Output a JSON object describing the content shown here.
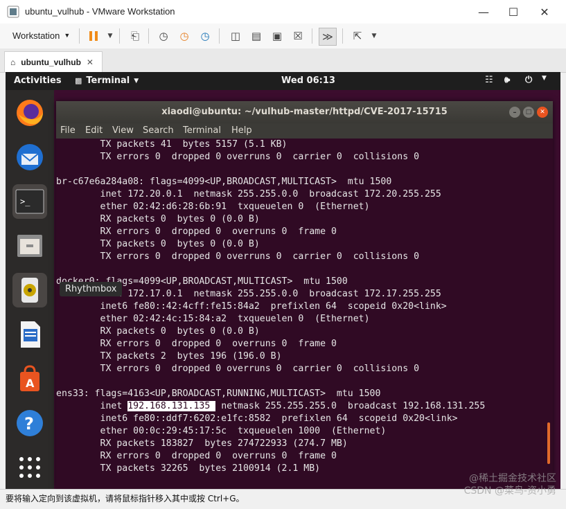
{
  "window": {
    "title": "ubuntu_vulhub - VMware Workstation"
  },
  "toolbar": {
    "workstation_label": "Workstation"
  },
  "tab": {
    "label": "ubuntu_vulhub"
  },
  "guest": {
    "activities_label": "Activities",
    "app_menu_label": "Terminal",
    "clock": "Wed 06:13",
    "tooltip": "Rhythmbox",
    "dock_icons": [
      "firefox-icon",
      "thunderbird-icon",
      "terminal-icon",
      "files-icon",
      "rhythmbox-icon",
      "writer-icon",
      "software-center-icon",
      "help-icon",
      "show-apps-icon"
    ]
  },
  "terminal": {
    "title": "xiaodi@ubuntu: ~/vulhub-master/httpd/CVE-2017-15715",
    "menu": [
      "File",
      "Edit",
      "View",
      "Search",
      "Terminal",
      "Help"
    ],
    "lines_before": [
      "        TX packets 41  bytes 5157 (5.1 KB)",
      "        TX errors 0  dropped 0 overruns 0  carrier 0  collisions 0",
      "",
      "br-c67e6a284a08: flags=4099<UP,BROADCAST,MULTICAST>  mtu 1500",
      "        inet 172.20.0.1  netmask 255.255.0.0  broadcast 172.20.255.255",
      "        ether 02:42:d6:28:6b:91  txqueuelen 0  (Ethernet)",
      "        RX packets 0  bytes 0 (0.0 B)",
      "        RX errors 0  dropped 0  overruns 0  frame 0",
      "        TX packets 0  bytes 0 (0.0 B)",
      "        TX errors 0  dropped 0 overruns 0  carrier 0  collisions 0",
      "",
      "docker0: flags=4099<UP,BROADCAST,MULTICAST>  mtu 1500",
      "        inet 172.17.0.1  netmask 255.255.0.0  broadcast 172.17.255.255",
      "        inet6 fe80::42:4cff:fe15:84a2  prefixlen 64  scopeid 0x20<link>",
      "        ether 02:42:4c:15:84:a2  txqueuelen 0  (Ethernet)",
      "        RX packets 0  bytes 0 (0.0 B)",
      "        RX errors 0  dropped 0  overruns 0  frame 0",
      "        TX packets 2  bytes 196 (196.0 B)",
      "        TX errors 0  dropped 0 overruns 0  carrier 0  collisions 0",
      "",
      "ens33: flags=4163<UP,BROADCAST,RUNNING,MULTICAST>  mtu 1500"
    ],
    "inet_prefix": "        inet ",
    "inet_selected": "192.168.131.135 ",
    "inet_suffix": " netmask 255.255.255.0  broadcast 192.168.131.255",
    "lines_after": [
      "        inet6 fe80::ddf7:6202:e1fc:8582  prefixlen 64  scopeid 0x20<link>",
      "        ether 00:0c:29:45:17:5c  txqueuelen 1000  (Ethernet)",
      "        RX packets 183827  bytes 274722933 (274.7 MB)",
      "        RX errors 0  dropped 0  overruns 0  frame 0",
      "        TX packets 32265  bytes 2100914 (2.1 MB)"
    ]
  },
  "statusbar": {
    "text": "要将输入定向到该虚拟机，请将鼠标指针移入其中或按 Ctrl+G。"
  },
  "watermark": {
    "line1": "@稀土掘金技术社区",
    "line2": "CSDN @菜鸟-资小勇"
  },
  "colors": {
    "terminal_bg": "#300a24",
    "ubuntu_topbar": "#1e1e1e",
    "dock_bg": "#2c2a29",
    "accent": "#e95420"
  }
}
